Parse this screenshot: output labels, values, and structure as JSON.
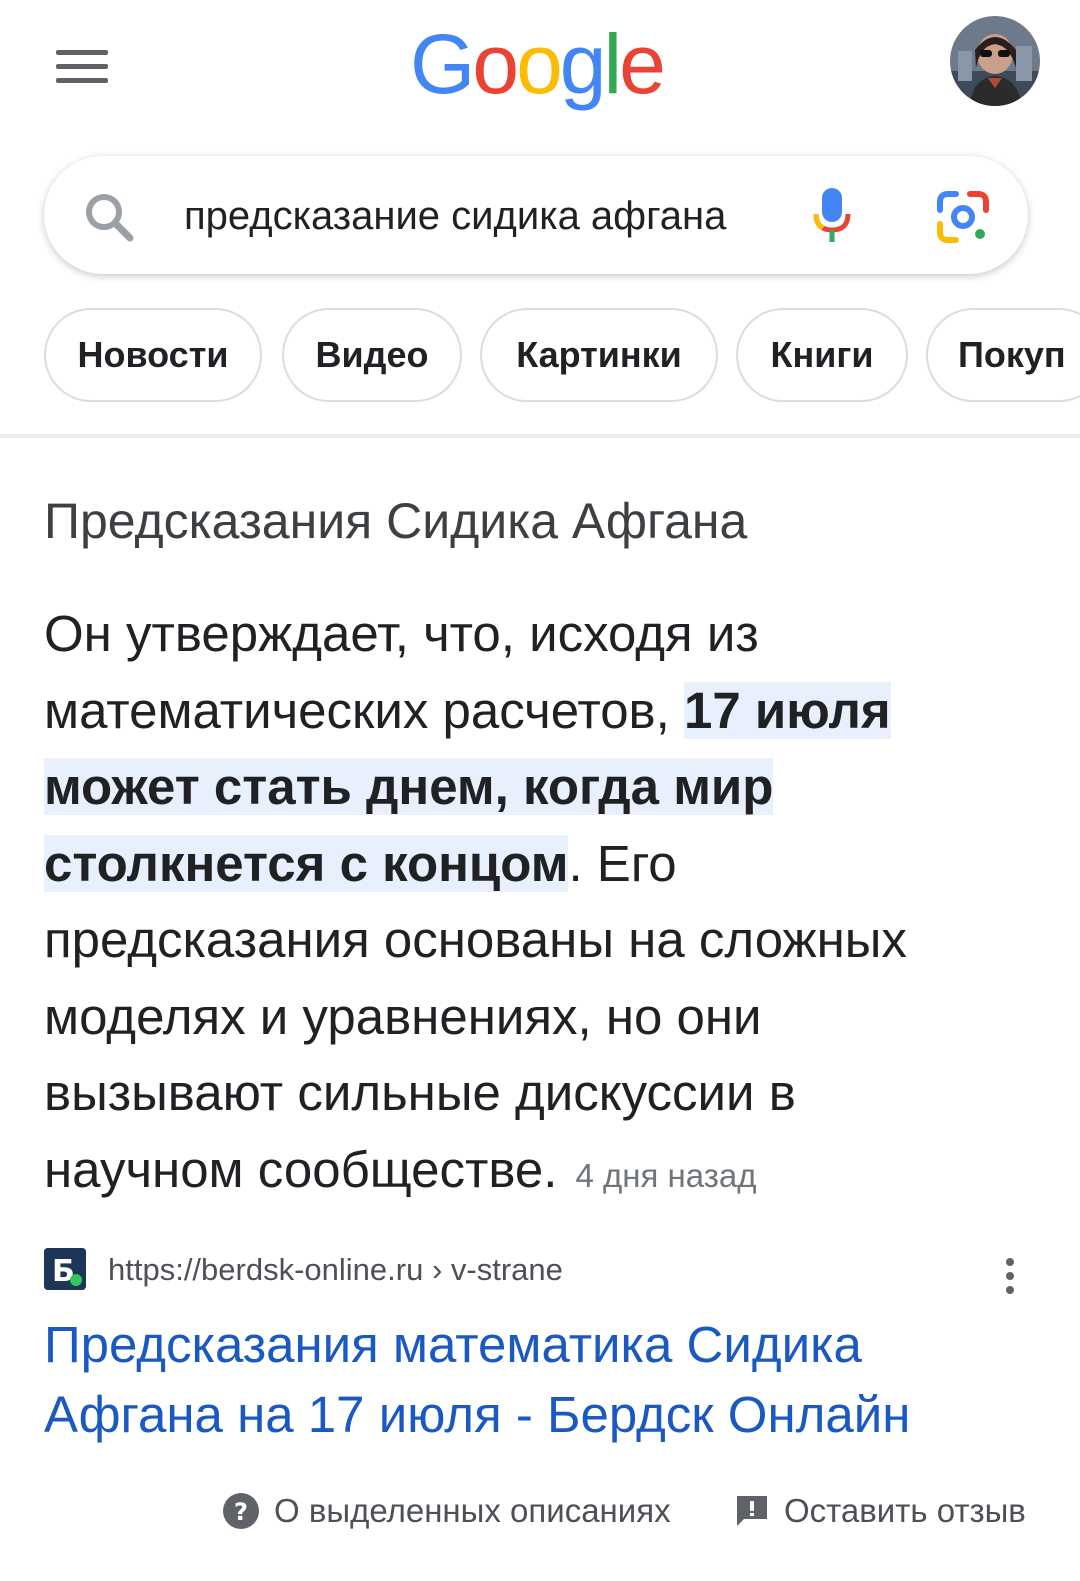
{
  "header": {
    "logo_letters": [
      {
        "ch": "G",
        "color": "#4285F4"
      },
      {
        "ch": "o",
        "color": "#EA4335"
      },
      {
        "ch": "o",
        "color": "#FBBC05"
      },
      {
        "ch": "g",
        "color": "#4285F4"
      },
      {
        "ch": "l",
        "color": "#34A853"
      },
      {
        "ch": "e",
        "color": "#EA4335"
      }
    ],
    "menu_icon": "hamburger-menu-icon",
    "avatar_icon": "user-avatar"
  },
  "search": {
    "query": "предсказание сидика афгана",
    "icons": [
      "search-icon",
      "microphone-icon",
      "google-lens-icon"
    ]
  },
  "chips": [
    {
      "label": "Новости"
    },
    {
      "label": "Видео"
    },
    {
      "label": "Картинки"
    },
    {
      "label": "Книги"
    },
    {
      "label": "Покуп"
    }
  ],
  "featured_snippet": {
    "title": "Предсказания Сидика Афгана",
    "text_before": "Он утверждает, что, исходя из математических расчетов, ",
    "highlight": "17 июля может стать днем, когда мир столкнется с концом",
    "text_after": ". Его предсказания основаны на сложных моделях и уравнениях, но они вызывают сильные дискуссии в научном сообществе.",
    "age": "4 дня назад"
  },
  "source": {
    "url": "https://berdsk-online.ru › v-strane",
    "favicon_letter": "Б",
    "link_title": "Предсказания математика Сидика Афгана на 17 июля - Бердск Онлайн",
    "more_icon": "more-vert-icon"
  },
  "footer": {
    "about_label": "О выделенных описаниях",
    "feedback_label": "Оставить отзыв",
    "colors": {
      "accent_link": "#1a58c2",
      "highlight_bg": "#e8f0fe"
    }
  }
}
